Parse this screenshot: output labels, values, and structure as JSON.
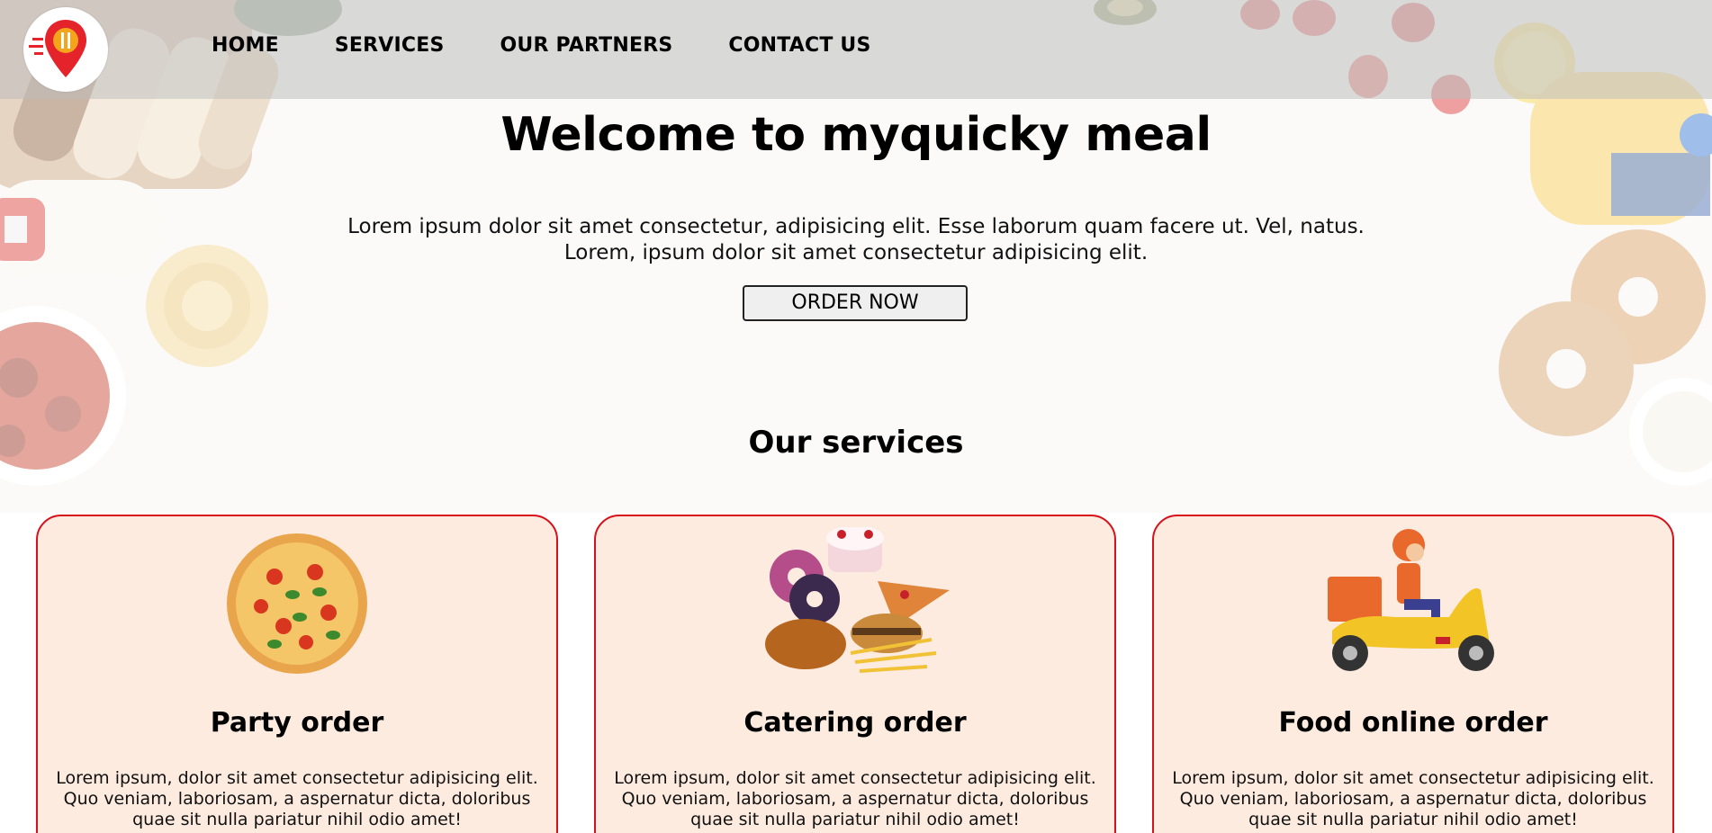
{
  "nav": {
    "items": [
      {
        "label": "HOME"
      },
      {
        "label": "SERVICES"
      },
      {
        "label": "OUR PARTNERS"
      },
      {
        "label": "CONTACT US"
      }
    ],
    "logo_icon": "location-pin-fork-knife-icon"
  },
  "hero": {
    "title": "Welcome to myquicky meal",
    "text_line1": "Lorem ipsum dolor sit amet consectetur, adipisicing elit. Esse laborum quam facere ut. Vel, natus.",
    "text_line2": "Lorem, ipsum dolor sit amet consectetur adipisicing elit.",
    "order_button": "ORDER NOW"
  },
  "services": {
    "title": "Our services",
    "cards": [
      {
        "title": "Party order",
        "image": "pizza-image",
        "text": "Lorem ipsum, dolor sit amet consectetur adipisicing elit. Quo veniam, laboriosam, a aspernatur dicta, doloribus quae sit nulla pariatur nihil odio amet!"
      },
      {
        "title": "Catering order",
        "image": "catering-food-image",
        "text": "Lorem ipsum, dolor sit amet consectetur adipisicing elit. Quo veniam, laboriosam, a aspernatur dicta, doloribus quae sit nulla pariatur nihil odio amet!"
      },
      {
        "title": "Food online order",
        "image": "delivery-scooter-image",
        "text": "Lorem ipsum, dolor sit amet consectetur adipisicing elit. Quo veniam, laboriosam, a aspernatur dicta, doloribus quae sit nulla pariatur nihil odio amet!"
      }
    ]
  },
  "colors": {
    "accent_red": "#d7101b",
    "card_background": "#fdebe0",
    "navbar_background": "#bebebe"
  }
}
